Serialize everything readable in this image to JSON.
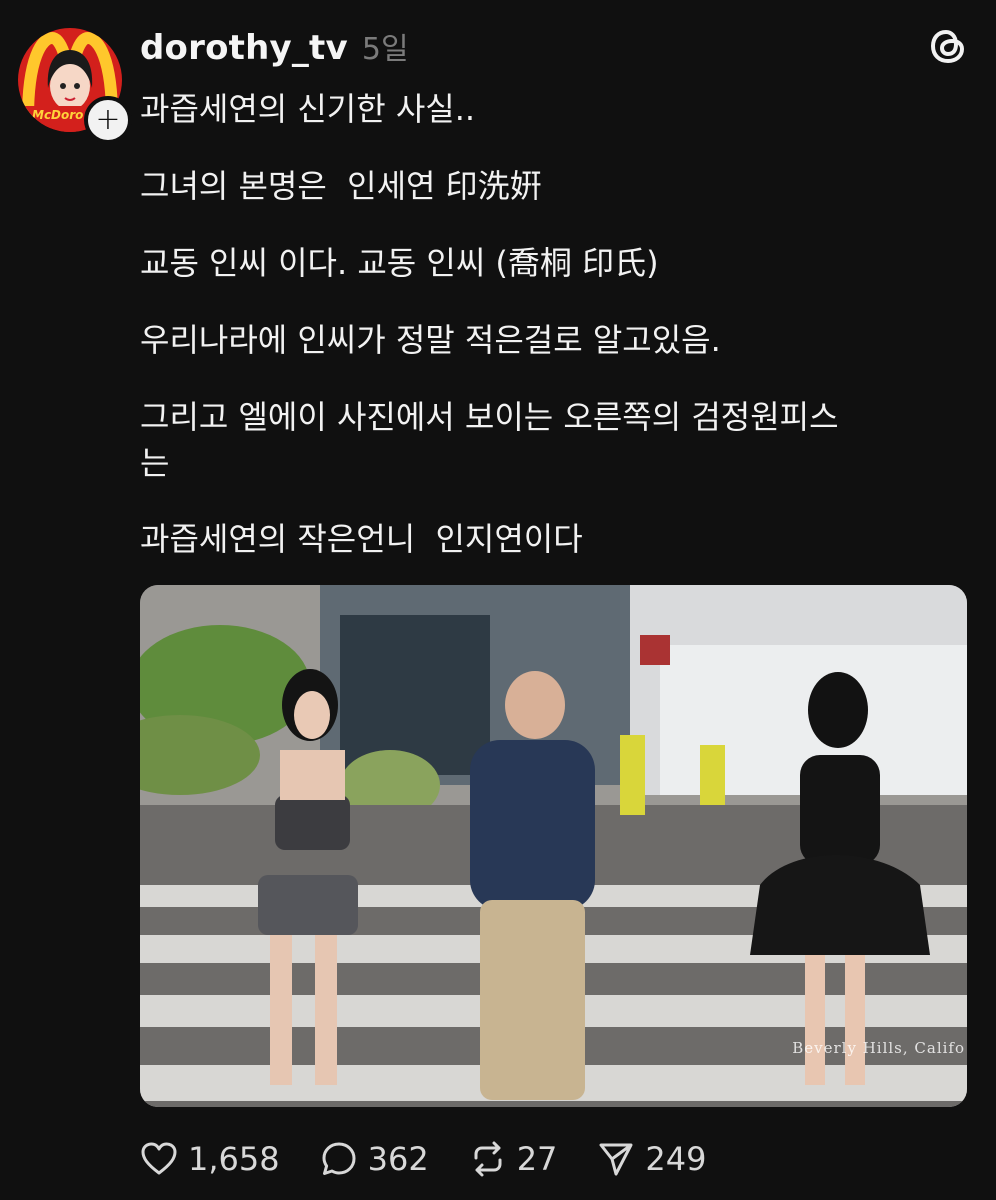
{
  "post": {
    "username": "dorothy_tv",
    "time_ago": "5일",
    "avatar_brand": "McDoro",
    "follow_symbol": "+",
    "paragraphs": [
      "과즙세연의 신기한 사실..",
      "그녀의 본명은  인세연 印洗姸",
      "교동 인씨 이다. 교동 인씨 (喬桐 印氏)",
      "우리나라에 인씨가 정말 적은걸로 알고있음.",
      "그리고 엘에이 사진에서 보이는 오른쪽의 검정원피스\n는",
      "과즙세연의 작은언니  인지연이다"
    ],
    "media_watermark": "Beverly Hills, Califo"
  },
  "actions": {
    "likes": "1,658",
    "replies": "362",
    "reposts": "27",
    "shares": "249"
  },
  "icons": {
    "like": "heart-icon",
    "reply": "comment-icon",
    "repost": "repost-icon",
    "share": "send-icon",
    "app": "threads-logo-icon"
  },
  "colors": {
    "background": "#101010",
    "text": "#f2f2f2",
    "muted": "#7b7b7b",
    "avatar_bg": "#d3201c"
  }
}
